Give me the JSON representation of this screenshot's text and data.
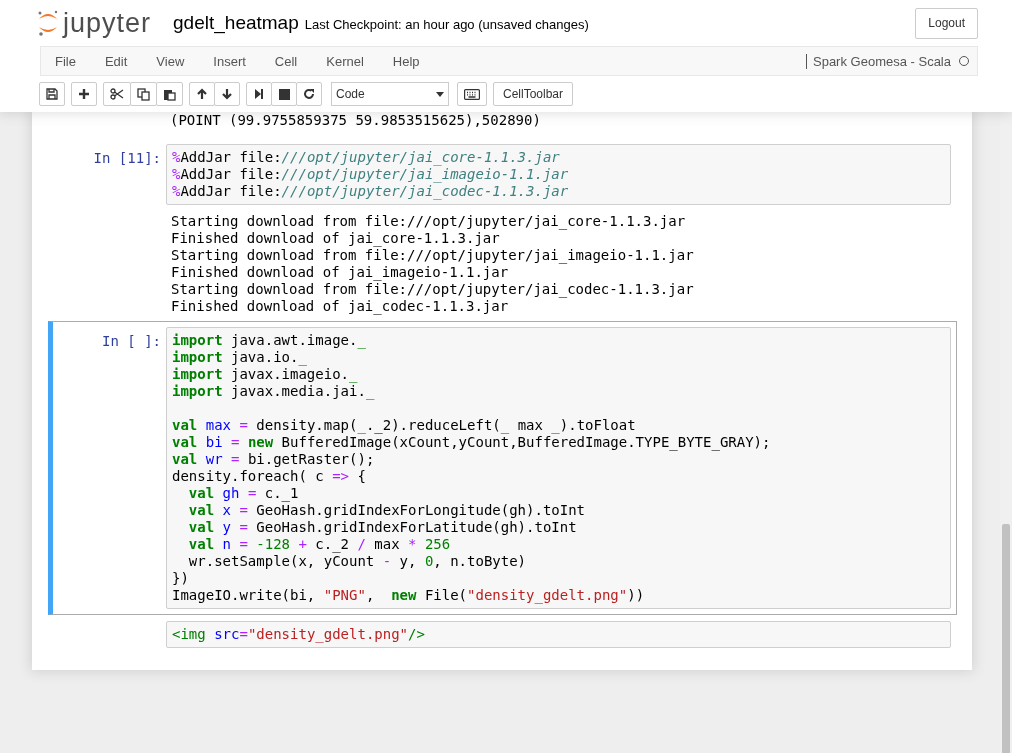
{
  "header": {
    "logo": "jupyter",
    "notebook_name": "gdelt_heatmap",
    "checkpoint": "Last Checkpoint: an hour ago (unsaved changes)",
    "logout": "Logout"
  },
  "menu": [
    "File",
    "Edit",
    "View",
    "Insert",
    "Cell",
    "Kernel",
    "Help"
  ],
  "kernel": {
    "name": "Spark Geomesa - Scala",
    "busy": false
  },
  "toolbar": {
    "cell_type": "Code",
    "celltoolbar": "CellToolbar"
  },
  "partial_output": "(POINT (99.9755859375 59.9853515625),502890)",
  "cells": [
    {
      "kind": "code",
      "prompt": "In [11]:",
      "selected": false,
      "blocks": [
        [
          [
            {
              "kind": "magic",
              "text": "%"
            },
            {
              "kind": "plain",
              "text": "AddJar file:"
            },
            {
              "kind": "path",
              "text": "///opt/jupyter/jai_core-1.1.3.jar"
            }
          ],
          [
            {
              "kind": "magic",
              "text": "%"
            },
            {
              "kind": "plain",
              "text": "AddJar file:"
            },
            {
              "kind": "path",
              "text": "///opt/jupyter/jai_imageio-1.1.jar"
            }
          ],
          [
            {
              "kind": "magic",
              "text": "%"
            },
            {
              "kind": "plain",
              "text": "AddJar file:"
            },
            {
              "kind": "path",
              "text": "///opt/jupyter/jai_codec-1.1.3.jar"
            }
          ]
        ]
      ],
      "output": [
        "Starting download from file:///opt/jupyter/jai_core-1.1.3.jar",
        "Finished download of jai_core-1.1.3.jar",
        "Starting download from file:///opt/jupyter/jai_imageio-1.1.jar",
        "Finished download of jai_imageio-1.1.jar",
        "Starting download from file:///opt/jupyter/jai_codec-1.1.3.jar",
        "Finished download of jai_codec-1.1.3.jar"
      ]
    },
    {
      "kind": "code",
      "prompt": "In [ ]:",
      "selected": true,
      "blocks": [
        [
          [
            {
              "kind": "kw",
              "text": "import"
            },
            {
              "kind": "plain",
              "text": " java.awt.image."
            },
            {
              "kind": "sym",
              "text": "_"
            }
          ],
          [
            {
              "kind": "kw",
              "text": "import"
            },
            {
              "kind": "plain",
              "text": " java.io."
            },
            {
              "kind": "sym",
              "text": "_"
            }
          ],
          [
            {
              "kind": "kw",
              "text": "import"
            },
            {
              "kind": "plain",
              "text": " javax.imageio."
            },
            {
              "kind": "sym",
              "text": "_"
            }
          ],
          [
            {
              "kind": "kw",
              "text": "import"
            },
            {
              "kind": "plain",
              "text": " javax.media.jai."
            },
            {
              "kind": "sym",
              "text": "_"
            }
          ]
        ],
        [
          [
            {
              "kind": "kw",
              "text": "val"
            },
            {
              "kind": "var",
              "text": " max "
            },
            {
              "kind": "op",
              "text": "="
            },
            {
              "kind": "plain",
              "text": " density.map("
            },
            {
              "kind": "sym",
              "text": "_"
            },
            {
              "kind": "plain",
              "text": "._2).reduceLeft("
            },
            {
              "kind": "sym",
              "text": "_"
            },
            {
              "kind": "plain",
              "text": " max "
            },
            {
              "kind": "sym",
              "text": "_"
            },
            {
              "kind": "plain",
              "text": ").toFloat"
            }
          ],
          [
            {
              "kind": "kw",
              "text": "val"
            },
            {
              "kind": "var",
              "text": " bi "
            },
            {
              "kind": "op",
              "text": "="
            },
            {
              "kind": "kw",
              "text": " new"
            },
            {
              "kind": "plain",
              "text": " BufferedImage(xCount,yCount,BufferedImage.TYPE_BYTE_GRAY);"
            }
          ],
          [
            {
              "kind": "kw",
              "text": "val"
            },
            {
              "kind": "var",
              "text": " wr "
            },
            {
              "kind": "op",
              "text": "="
            },
            {
              "kind": "plain",
              "text": " bi.getRaster();"
            }
          ],
          [
            {
              "kind": "plain",
              "text": "density.foreach( c "
            },
            {
              "kind": "op",
              "text": "=>"
            },
            {
              "kind": "plain",
              "text": " {"
            }
          ],
          [
            {
              "kind": "kw",
              "text": "  val"
            },
            {
              "kind": "var",
              "text": " gh "
            },
            {
              "kind": "op",
              "text": "="
            },
            {
              "kind": "plain",
              "text": " c._1"
            }
          ],
          [
            {
              "kind": "kw",
              "text": "  val"
            },
            {
              "kind": "var",
              "text": " x "
            },
            {
              "kind": "op",
              "text": "="
            },
            {
              "kind": "plain",
              "text": " GeoHash.gridIndexForLongitude(gh).toInt"
            }
          ],
          [
            {
              "kind": "kw",
              "text": "  val"
            },
            {
              "kind": "var",
              "text": " y "
            },
            {
              "kind": "op",
              "text": "="
            },
            {
              "kind": "plain",
              "text": " GeoHash.gridIndexForLatitude(gh).toInt"
            }
          ],
          [
            {
              "kind": "kw",
              "text": "  val"
            },
            {
              "kind": "var",
              "text": " n "
            },
            {
              "kind": "op",
              "text": "="
            },
            {
              "kind": "num",
              "text": " -128 "
            },
            {
              "kind": "op",
              "text": "+"
            },
            {
              "kind": "plain",
              "text": " c._2 "
            },
            {
              "kind": "op",
              "text": "/"
            },
            {
              "kind": "plain",
              "text": " max "
            },
            {
              "kind": "op",
              "text": "*"
            },
            {
              "kind": "num",
              "text": " 256"
            }
          ],
          [
            {
              "kind": "plain",
              "text": "  wr.setSample(x, yCount "
            },
            {
              "kind": "op",
              "text": "-"
            },
            {
              "kind": "plain",
              "text": " y, "
            },
            {
              "kind": "num",
              "text": "0"
            },
            {
              "kind": "plain",
              "text": ", n.toByte)"
            }
          ],
          [
            {
              "kind": "plain",
              "text": "})"
            }
          ],
          [
            {
              "kind": "plain",
              "text": "ImageIO.write(bi, "
            },
            {
              "kind": "str",
              "text": "\"PNG\""
            },
            {
              "kind": "plain",
              "text": ",  "
            },
            {
              "kind": "kw",
              "text": "new"
            },
            {
              "kind": "plain",
              "text": " File("
            },
            {
              "kind": "str",
              "text": "\"density_gdelt.png\""
            },
            {
              "kind": "plain",
              "text": "))"
            }
          ]
        ]
      ]
    },
    {
      "kind": "raw",
      "selected": false,
      "blocks": [
        [
          [
            {
              "kind": "tag",
              "text": "<img"
            },
            {
              "kind": "attr",
              "text": " src"
            },
            {
              "kind": "op",
              "text": "="
            },
            {
              "kind": "str",
              "text": "\"density_gdelt.png\""
            },
            {
              "kind": "tag",
              "text": "/>"
            }
          ]
        ]
      ]
    }
  ]
}
